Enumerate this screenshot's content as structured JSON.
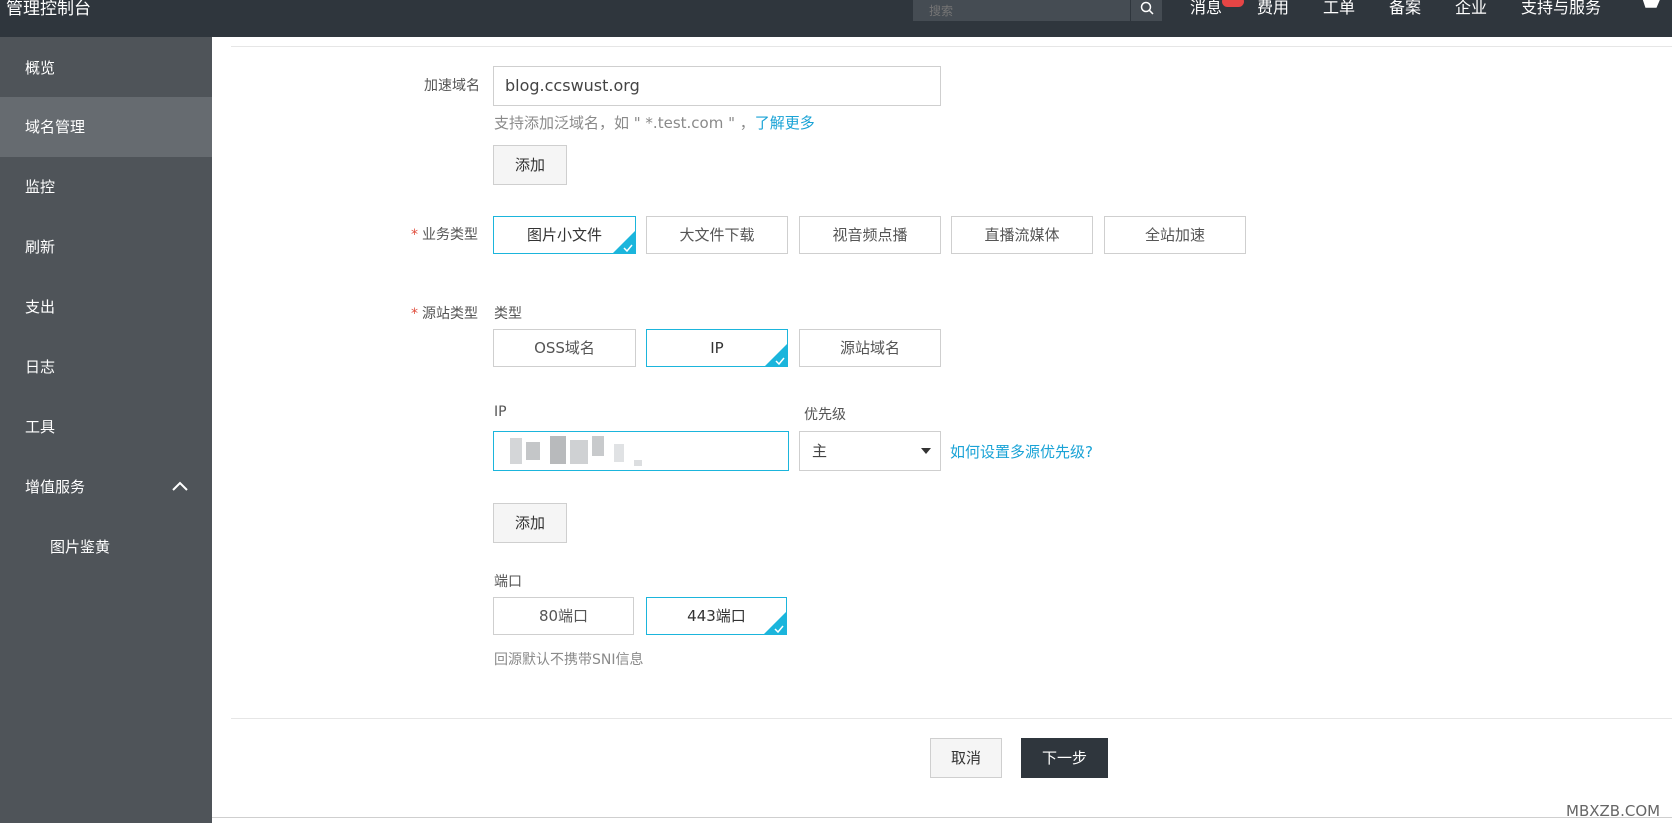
{
  "header": {
    "brand": "管理控制台",
    "search_placeholder": "搜索",
    "nav": {
      "messages": "消息",
      "fees": "费用",
      "tickets": "工单",
      "filing": "备案",
      "enterprise": "企业",
      "support": "支持与服务"
    }
  },
  "sidebar": {
    "items": [
      {
        "label": "概览"
      },
      {
        "label": "域名管理"
      },
      {
        "label": "监控"
      },
      {
        "label": "刷新"
      },
      {
        "label": "支出"
      },
      {
        "label": "日志"
      },
      {
        "label": "工具"
      },
      {
        "label": "增值服务"
      },
      {
        "label": "图片鉴黄"
      }
    ]
  },
  "form": {
    "domain": {
      "label": "加速域名",
      "value": "blog.ccswust.org",
      "hint": "支持添加泛域名，如 \" *.test.com \" ，",
      "hint_link": "了解更多",
      "add_label": "添加"
    },
    "business_type": {
      "label": "业务类型",
      "options": [
        "图片小文件",
        "大文件下载",
        "视音频点播",
        "直播流媒体",
        "全站加速"
      ],
      "selected": "图片小文件"
    },
    "origin_type": {
      "label": "源站类型",
      "sub_label": "类型",
      "options": [
        "OSS域名",
        "IP",
        "源站域名"
      ],
      "selected": "IP"
    },
    "origin": {
      "ip_label": "IP",
      "priority_label": "优先级",
      "priority_value": "主",
      "priority_link": "如何设置多源优先级?",
      "add_label": "添加"
    },
    "port": {
      "label": "端口",
      "options": [
        "80端口",
        "443端口"
      ],
      "selected": "443端口",
      "note": "回源默认不携带SNI信息"
    }
  },
  "footer": {
    "cancel": "取消",
    "next": "下一步"
  },
  "watermark": "MBXZB.COM",
  "colors": {
    "accent": "#1bb5dc",
    "topbar": "#2f363d",
    "sidebar": "#4f5459"
  }
}
